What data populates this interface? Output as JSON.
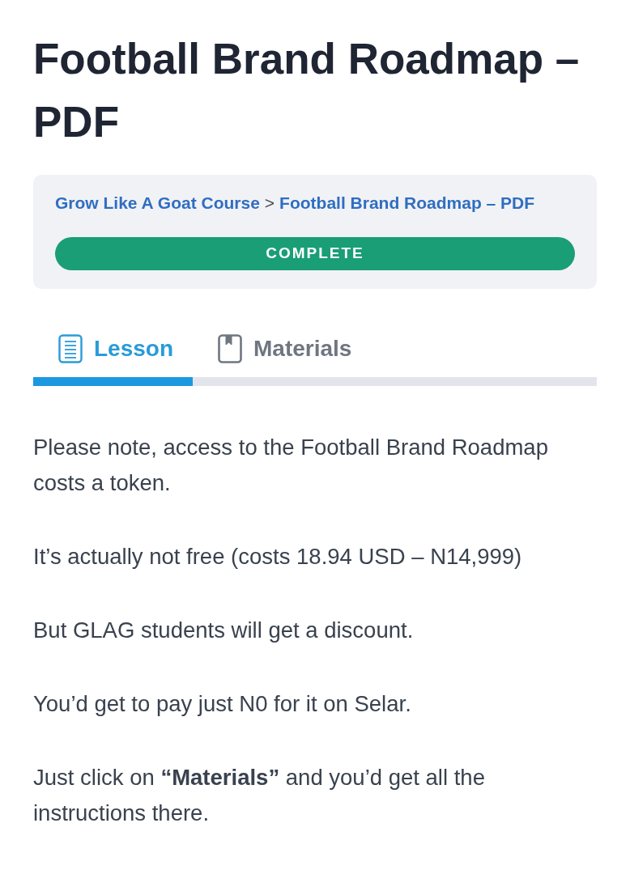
{
  "page": {
    "title": "Football Brand Roadmap – PDF"
  },
  "breadcrumb": {
    "items": [
      {
        "label": "Grow Like A Goat Course"
      },
      {
        "label": "Football Brand Roadmap – PDF"
      }
    ],
    "separator": ">"
  },
  "complete_button": {
    "label": "COMPLETE"
  },
  "tabs": [
    {
      "label": "Lesson",
      "selected": true
    },
    {
      "label": "Materials",
      "selected": false
    }
  ],
  "content": {
    "paragraphs": [
      "Please note, access to the Football Brand Roadmap costs a token.",
      "It’s actually not free (costs 18.94 USD – N14,999)",
      "But GLAG students will get a discount.",
      "You’d get to pay just N0 for it on Selar.",
      "Just click on **“Materials”** and you’d get all the instructions there."
    ]
  }
}
